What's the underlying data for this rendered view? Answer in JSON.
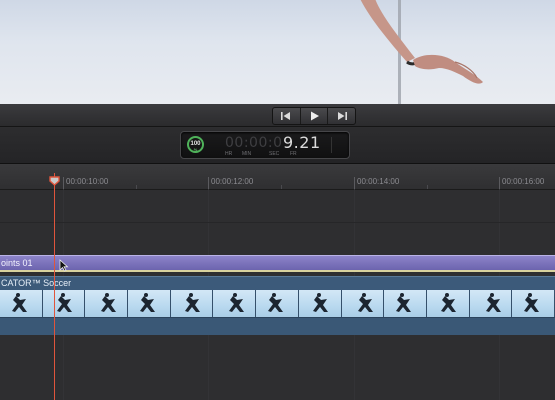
{
  "viewer": {
    "content": "clip-preview"
  },
  "transport": {
    "prev_icon": "skip-back-icon",
    "play_icon": "play-icon",
    "next_icon": "skip-forward-icon"
  },
  "timecode": {
    "percent": "100",
    "percent_unit": "%",
    "dim_digits": "00:00:0",
    "value": "9.21",
    "labels": {
      "hr": "HR",
      "min": "MIN",
      "sec": "SEC",
      "fr": "FR"
    }
  },
  "ruler": {
    "ticks": [
      "00:00:10:00",
      "00:00:12:00",
      "00:00:14:00",
      "00:00:16:00"
    ]
  },
  "clips": {
    "title_clip_label": "oints 01",
    "video_clip_label": "CATOR™ Soccer"
  },
  "colors": {
    "playhead": "#e0553c",
    "title_clip": "#7a72bd",
    "video_clip": "#3c5a7a",
    "percent_ring": "#4fb25a"
  }
}
